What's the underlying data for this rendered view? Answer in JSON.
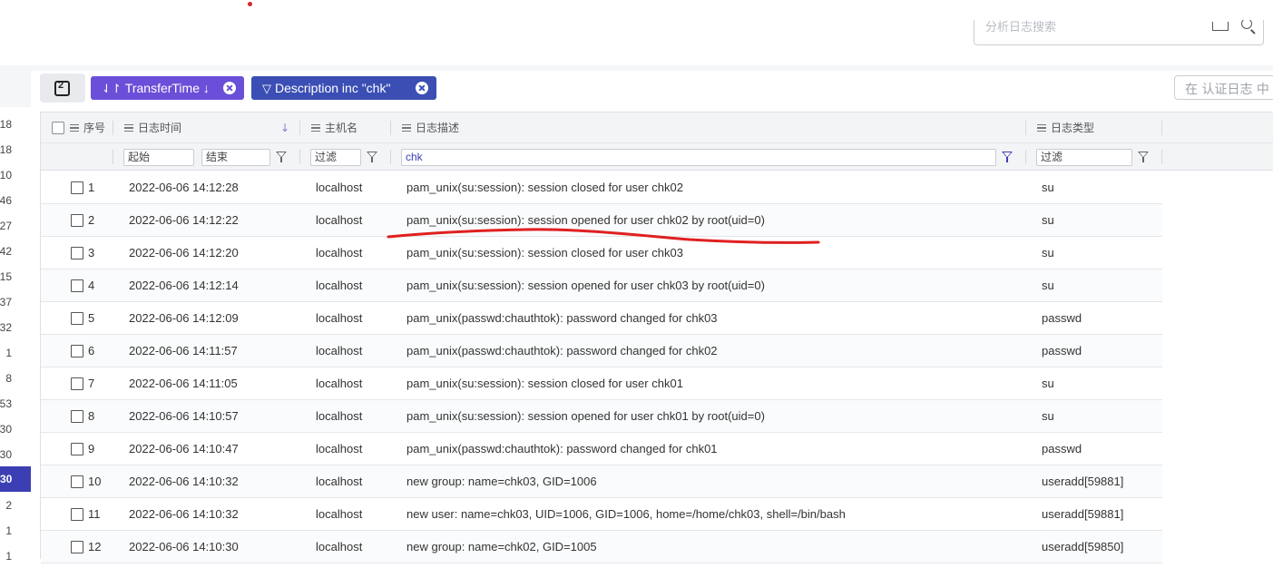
{
  "top_search": {
    "placeholder": "分析日志搜索"
  },
  "left_strip": {
    "numbers": [
      "18",
      "18",
      "10",
      "46",
      "27",
      "42",
      "15",
      "37",
      "32",
      "1",
      "8",
      "53",
      "30",
      "30",
      "30",
      "2",
      "1",
      "1"
    ],
    "selected_index": 14
  },
  "toolbar": {
    "sort_chip_label": "TransferTime ↓",
    "filter_chip_label": "Description inc \"chk\"",
    "right_search_placeholder": "在 认证日志 中"
  },
  "table": {
    "headers": {
      "index": "序号",
      "time": "日志时间",
      "host": "主机名",
      "desc": "日志描述",
      "type": "日志类型"
    },
    "filters": {
      "time_start": "起始",
      "time_end": "结束",
      "host": "过滤",
      "desc": "chk",
      "type": "过滤"
    },
    "rows": [
      {
        "n": "1",
        "time": "2022-06-06 14:12:28",
        "host": "localhost",
        "desc": "pam_unix(su:session): session closed for user chk02",
        "type": "su"
      },
      {
        "n": "2",
        "time": "2022-06-06 14:12:22",
        "host": "localhost",
        "desc": "pam_unix(su:session): session opened for user chk02 by root(uid=0)",
        "type": "su"
      },
      {
        "n": "3",
        "time": "2022-06-06 14:12:20",
        "host": "localhost",
        "desc": "pam_unix(su:session): session closed for user chk03",
        "type": "su"
      },
      {
        "n": "4",
        "time": "2022-06-06 14:12:14",
        "host": "localhost",
        "desc": "pam_unix(su:session): session opened for user chk03 by root(uid=0)",
        "type": "su"
      },
      {
        "n": "5",
        "time": "2022-06-06 14:12:09",
        "host": "localhost",
        "desc": "pam_unix(passwd:chauthtok): password changed for chk03",
        "type": "passwd"
      },
      {
        "n": "6",
        "time": "2022-06-06 14:11:57",
        "host": "localhost",
        "desc": "pam_unix(passwd:chauthtok): password changed for chk02",
        "type": "passwd"
      },
      {
        "n": "7",
        "time": "2022-06-06 14:11:05",
        "host": "localhost",
        "desc": "pam_unix(su:session): session closed for user chk01",
        "type": "su"
      },
      {
        "n": "8",
        "time": "2022-06-06 14:10:57",
        "host": "localhost",
        "desc": "pam_unix(su:session): session opened for user chk01 by root(uid=0)",
        "type": "su"
      },
      {
        "n": "9",
        "time": "2022-06-06 14:10:47",
        "host": "localhost",
        "desc": "pam_unix(passwd:chauthtok): password changed for chk01",
        "type": "passwd"
      },
      {
        "n": "10",
        "time": "2022-06-06 14:10:32",
        "host": "localhost",
        "desc": "new group: name=chk03, GID=1006",
        "type": "useradd[59881]"
      },
      {
        "n": "11",
        "time": "2022-06-06 14:10:32",
        "host": "localhost",
        "desc": "new user: name=chk03, UID=1006, GID=1006, home=/home/chk03, shell=/bin/bash",
        "type": "useradd[59881]"
      },
      {
        "n": "12",
        "time": "2022-06-06 14:10:30",
        "host": "localhost",
        "desc": "new group: name=chk02, GID=1005",
        "type": "useradd[59850]"
      }
    ]
  },
  "colors": {
    "accent": "#3b3fb3",
    "sort_chip": "#6b4fd8",
    "filter_chip": "#3b4eb4",
    "annotation": "#e02020"
  }
}
